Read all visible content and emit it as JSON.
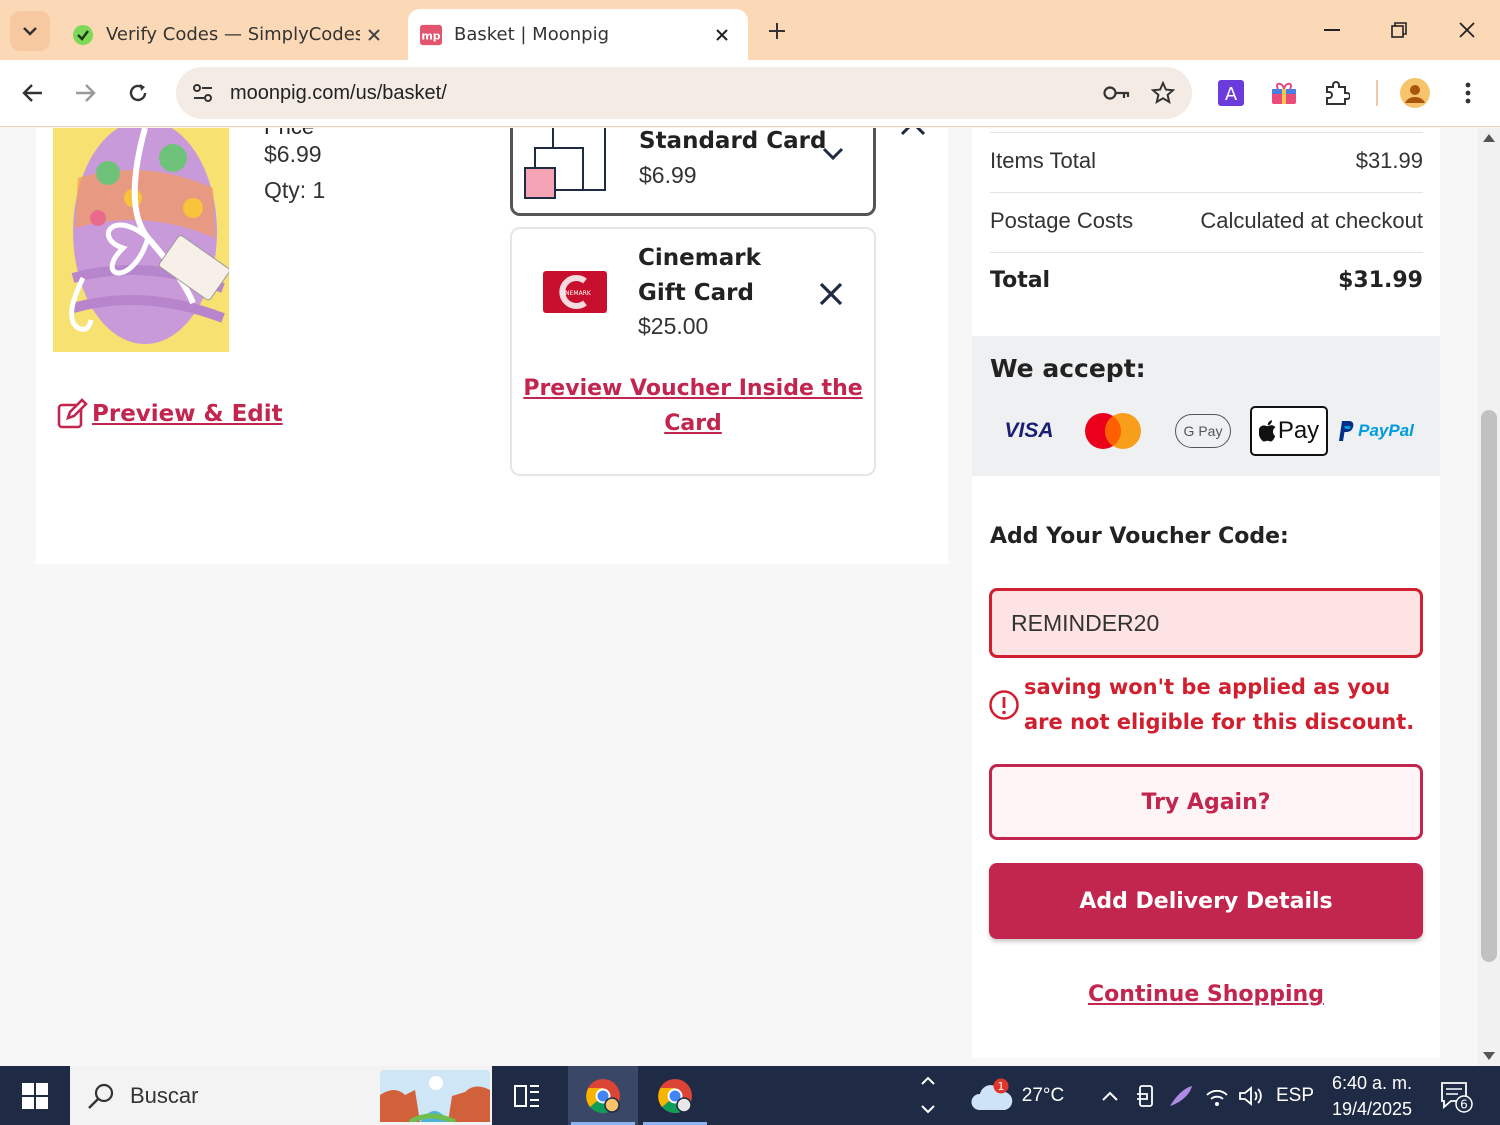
{
  "browser": {
    "tabs": [
      {
        "title": "Verify Codes — SimplyCodes",
        "active": false
      },
      {
        "title": "Basket | Moonpig",
        "active": true
      }
    ],
    "favicon_mp": "mp",
    "url": "moonpig.com/us/basket/",
    "profile_initial": "A"
  },
  "basket": {
    "price_label": "Price",
    "card_price": "$6.99",
    "qty": "Qty: 1",
    "preview_edit": "Preview & Edit",
    "standard_card": {
      "name": "Standard Card",
      "price": "$6.99"
    },
    "gift_card": {
      "name": "Cinemark Gift Card",
      "price": "$25.00",
      "logo_text": "CINEMARK",
      "preview_link": "Preview Voucher Inside the Card"
    }
  },
  "summary": {
    "items_total_label": "Items Total",
    "items_total_value": "$31.99",
    "postage_label": "Postage Costs",
    "postage_value": "Calculated at checkout",
    "total_label": "Total",
    "total_value": "$31.99",
    "we_accept": "We accept:",
    "payment_methods": {
      "visa": "VISA",
      "gpay": "G Pay",
      "applepay": "Pay",
      "paypal": "PayPal"
    },
    "voucher_label": "Add Your Voucher Code:",
    "voucher_value": "REMINDER20",
    "voucher_error": "saving won't be applied as you are not eligible for this discount.",
    "try_again": "Try Again?",
    "add_delivery": "Add Delivery Details",
    "continue_shopping": "Continue Shopping"
  },
  "taskbar": {
    "search_placeholder": "Buscar",
    "weather_temp": "27°C",
    "weather_badge": "1",
    "language": "ESP",
    "time": "6:40 a. m.",
    "date": "19/4/2025",
    "notifications": "6"
  },
  "colors": {
    "brand": "#c2254e",
    "error": "#d01f2e",
    "tabstrip": "#fcd9b6",
    "taskbar": "#1f2b44"
  }
}
